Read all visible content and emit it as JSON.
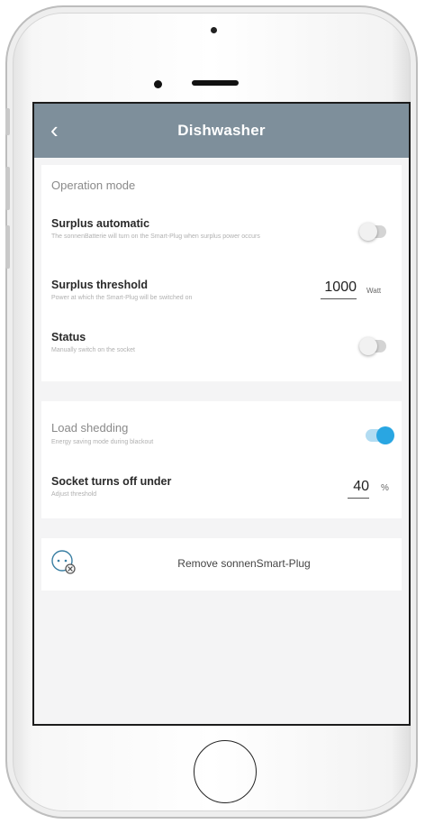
{
  "header": {
    "back_icon": "‹",
    "title": "Dishwasher"
  },
  "operation": {
    "section_label": "Operation mode",
    "surplus_automatic": {
      "title": "Surplus automatic",
      "description": "The sonnenBatterie will turn on the Smart-Plug when surplus power occurs",
      "enabled": false
    },
    "surplus_threshold": {
      "title": "Surplus threshold",
      "description": "Power at which the Smart-Plug will be switched on",
      "value": "1000",
      "unit": "Watt"
    },
    "status": {
      "title": "Status",
      "description": "Manually switch on the socket",
      "enabled": false
    }
  },
  "load_shedding": {
    "title": "Load shedding",
    "description": "Energy saving mode during blackout",
    "enabled": true,
    "socket_turns_off": {
      "title": "Socket turns off under",
      "description": "Adjust threshold",
      "value": "40",
      "unit": "%"
    }
  },
  "remove": {
    "icon": "smart-plug-remove-icon",
    "label": "Remove sonnenSmart-Plug"
  },
  "colors": {
    "header": "#7e8f9b",
    "accent": "#29a6e2"
  }
}
